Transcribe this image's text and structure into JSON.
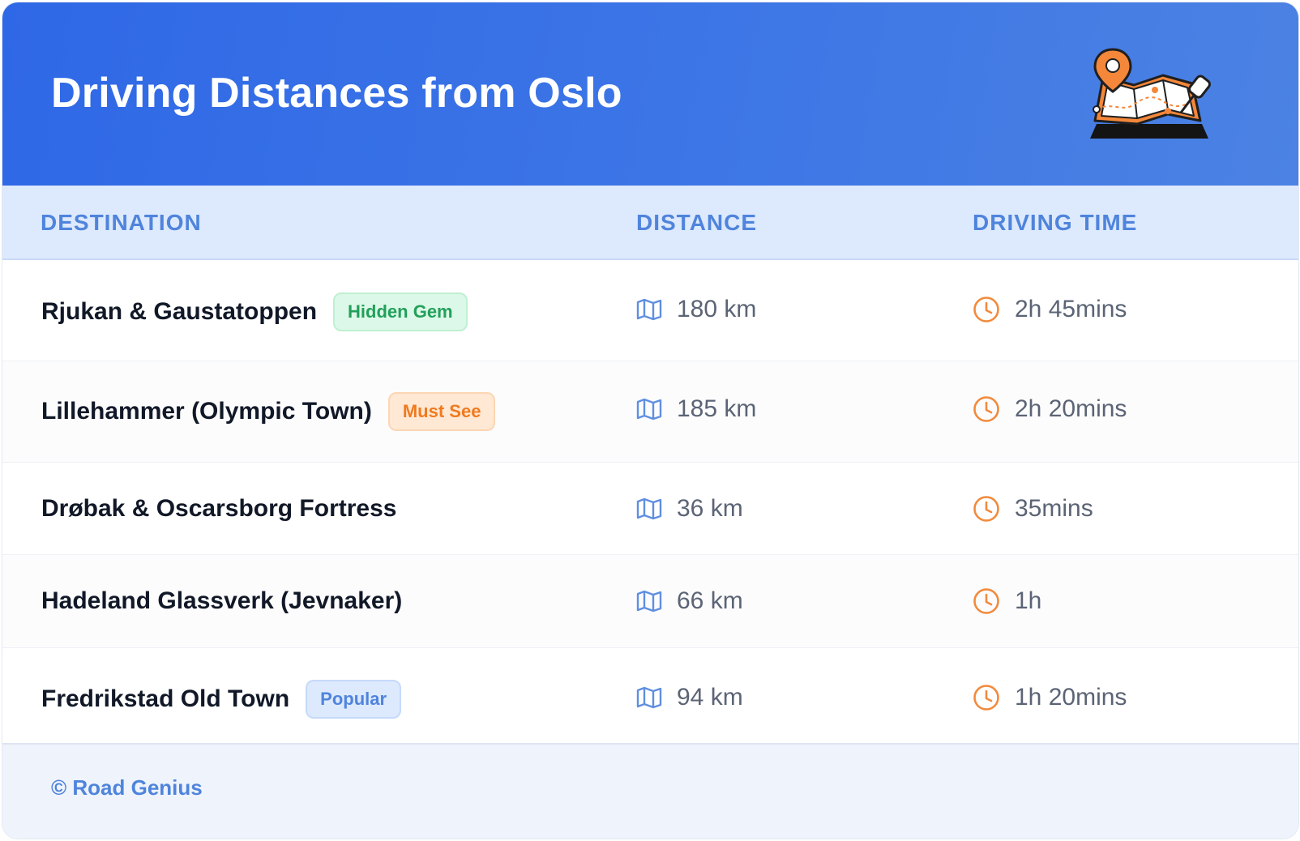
{
  "header": {
    "title": "Driving Distances from Oslo"
  },
  "columns": {
    "destination": "DESTINATION",
    "distance": "DISTANCE",
    "driving_time": "DRIVING TIME"
  },
  "rows": [
    {
      "destination": "Rjukan & Gaustatoppen",
      "badge": "Hidden Gem",
      "badge_color": "#22a05a",
      "distance": "180 km",
      "time": "2h 45mins"
    },
    {
      "destination": "Lillehammer (Olympic Town)",
      "badge": "Must See",
      "badge_color": "#f07a1e",
      "distance": "185 km",
      "time": "2h 20mins"
    },
    {
      "destination": "Drøbak & Oscarsborg Fortress",
      "badge": "",
      "distance": "36 km",
      "time": "35mins"
    },
    {
      "destination": "Hadeland Glassverk (Jevnaker)",
      "badge": "",
      "distance": "66 km",
      "time": "1h"
    },
    {
      "destination": "Fredrikstad Old Town",
      "badge": "Popular",
      "badge_color": "#4f84dc",
      "distance": "94 km",
      "time": "1h 20mins"
    }
  ],
  "footer": {
    "credit": "© Road Genius"
  },
  "icons": {
    "distance": "map-icon",
    "time": "clock-icon",
    "header": "map-with-pins-icon"
  },
  "colors": {
    "header_start": "#2f68e6",
    "header_end": "#4b82e3",
    "accent_blue": "#4f84dc",
    "accent_orange": "#f07a1e"
  }
}
